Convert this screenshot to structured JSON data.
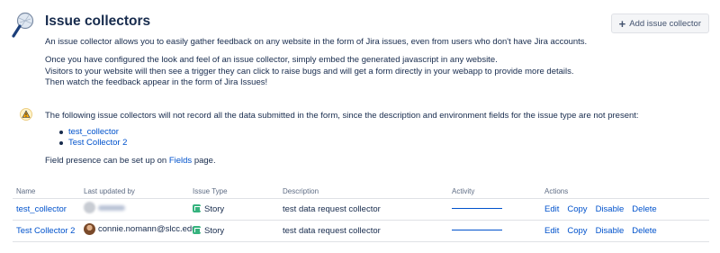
{
  "header": {
    "title": "Issue collectors",
    "add_label": "Add issue collector"
  },
  "intro": {
    "paragraph1": "An issue collector allows you to easily gather feedback on any website in the form of Jira issues, even from users who don't have Jira accounts.",
    "paragraph2_lines": [
      "Once you have configured the look and feel of an issue collector, simply embed the generated javascript in any website.",
      "Visitors to your website will then see a trigger they can click to raise bugs and will get a form directly in your webapp to provide more details.",
      "Then watch the feedback appear in the form of Jira Issues!"
    ]
  },
  "warning": {
    "message": "The following issue collectors will not record all the data submitted in the form, since the description and environment fields for the issue type are not present:",
    "collectors": [
      "test_collector",
      "Test Collector 2"
    ],
    "presence_prefix": "Field presence can be set up on ",
    "presence_link": "Fields",
    "presence_suffix": " page."
  },
  "table": {
    "columns": [
      "Name",
      "Last updated by",
      "Issue Type",
      "Description",
      "Activity",
      "Actions"
    ],
    "rows": [
      {
        "name": "test_collector",
        "user": "",
        "issue_type": "Story",
        "description": "test data request collector",
        "actions": [
          "Edit",
          "Copy",
          "Disable",
          "Delete"
        ]
      },
      {
        "name": "Test Collector 2",
        "user": "connie.nomann@slcc.edu",
        "issue_type": "Story",
        "description": "test data request collector",
        "actions": [
          "Edit",
          "Copy",
          "Disable",
          "Delete"
        ]
      }
    ]
  },
  "icons": {
    "logo": "issue-collector-logo-icon",
    "add": "plus-icon",
    "warning": "warning-icon",
    "issue_type": "story-icon",
    "avatar": "avatar"
  },
  "colors": {
    "link": "#0052cc",
    "text": "#172b4d",
    "muted": "#5e6c84",
    "warning": "#ffab00",
    "story": "#36b37e"
  }
}
